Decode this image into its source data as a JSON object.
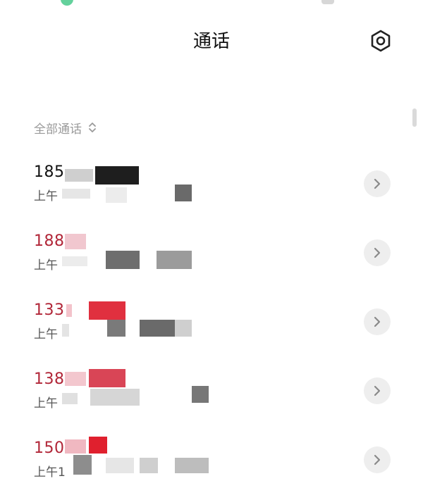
{
  "header": {
    "title": "通话",
    "settings_icon": "gear-icon"
  },
  "filter": {
    "label": "全部通话",
    "icon": "chevron-up-down-icon"
  },
  "calls": [
    {
      "number": "185",
      "time": "上午",
      "status": "normal"
    },
    {
      "number": "188",
      "time": "上午",
      "status": "missed"
    },
    {
      "number": "133",
      "time": "上午",
      "status": "missed"
    },
    {
      "number": "138",
      "time": "上午",
      "status": "missed"
    },
    {
      "number": "150",
      "time": "上午1",
      "status": "missed"
    }
  ],
  "colors": {
    "missed": "#b12638",
    "normal": "#111111",
    "secondary": "#9a9a9a"
  }
}
